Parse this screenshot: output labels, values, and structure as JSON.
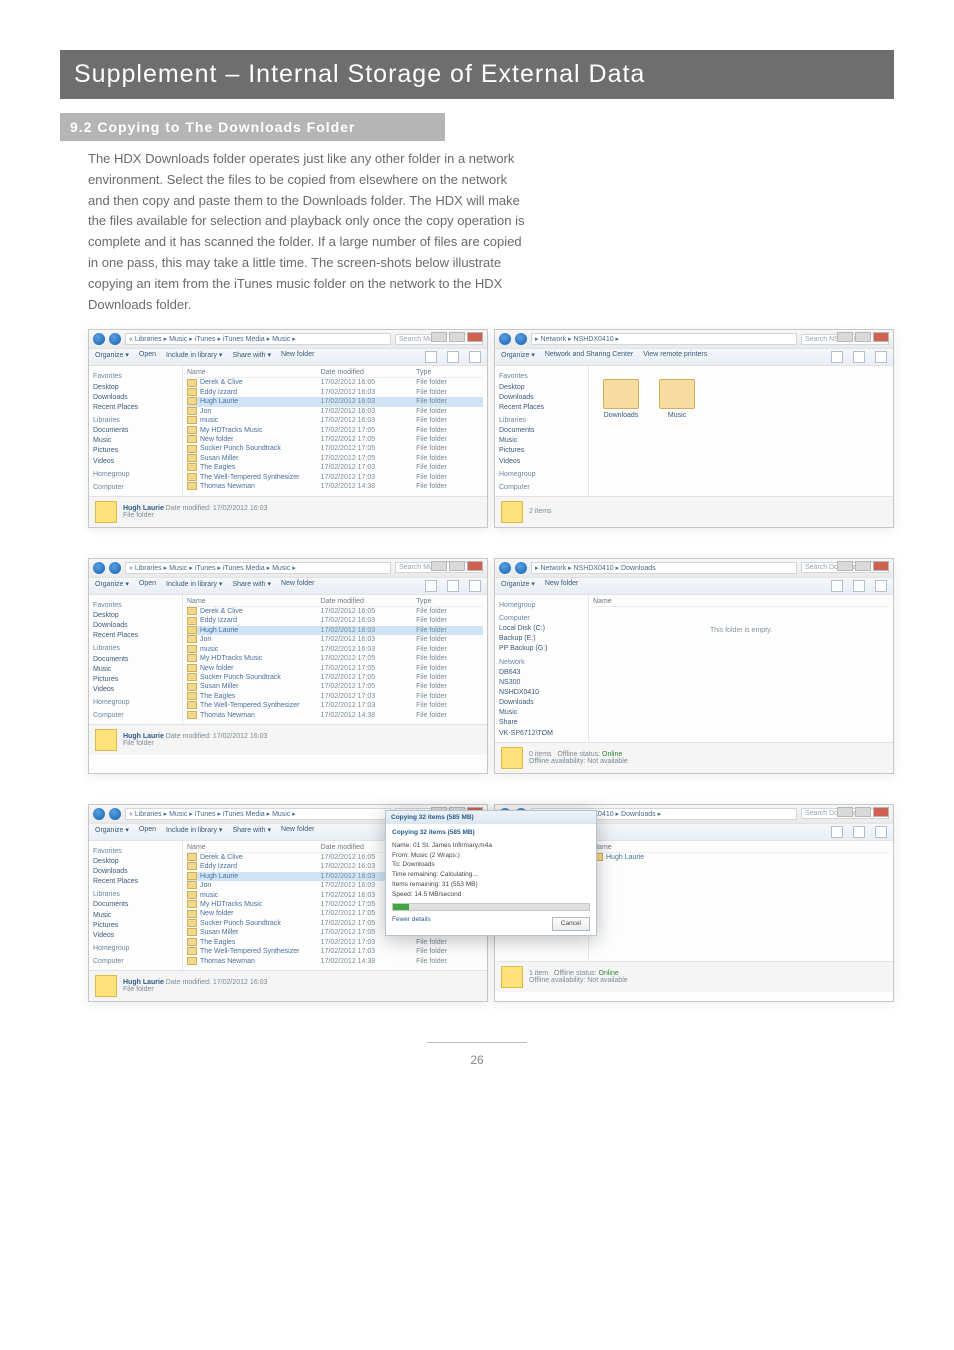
{
  "page": {
    "chapter_title": "Supplement – Internal Storage of External Data",
    "section_title": "9.2 Copying to The Downloads Folder",
    "paragraph": "The HDX Downloads folder operates just like any other folder in a network environment. Select the files to be copied from elsewhere on the network and then copy and paste them to the Downloads folder. The HDX will make the files available for selection and playback only once the copy operation is complete and it has scanned the folder. If a large number of files are copied in one pass, this may take a little time. The screen-shots below illustrate copying an item from the iTunes music folder on the network to the HDX Downloads folder.",
    "page_number": "26"
  },
  "common": {
    "toolbar": {
      "organize": "Organize ▾",
      "open": "Open",
      "include": "Include in library ▾",
      "sharewith": "Share with ▾",
      "newfolder": "New folder",
      "networkcenter": "Network and Sharing Center",
      "viewprinters": "View remote printers"
    },
    "cols": {
      "name": "Name",
      "date": "Date modified",
      "type": "Type"
    },
    "side": {
      "favorites": "Favorites",
      "desktop": "Desktop",
      "downloads": "Downloads",
      "recent": "Recent Places",
      "libraries": "Libraries",
      "documents": "Documents",
      "music": "Music",
      "pictures": "Pictures",
      "videos": "Videos",
      "homegroup": "Homegroup",
      "computer": "Computer",
      "localdisk": "Local Disk (C:)",
      "backup_e": "Backup (E:)",
      "ppbackup": "PP Backup (G:)",
      "network": "Network",
      "db643": "DB643",
      "ns300": "NS300",
      "nshdx": "NSHDX0410",
      "share": "Share",
      "mtp": "VK-SP6712\\TOM"
    },
    "footer": {
      "name": "Hugh Laurie",
      "date_label": "Date modified:",
      "date_val": "17/02/2012 16:03",
      "type": "File folder"
    },
    "items_label": "2 items",
    "offline_status_lbl": "Offline status:",
    "offline_status_val": "Online",
    "offline_avail_lbl": "Offline availability:",
    "offline_avail_val": "Not available",
    "one_item": "1 item"
  },
  "left_common": {
    "path": "« Libraries ▸ Music ▸ iTunes ▸ iTunes Media ▸ Music ▸",
    "search": "Search Music",
    "rows": [
      {
        "n": "Derek & Clive",
        "d": "17/02/2012 16:05",
        "t": "File folder"
      },
      {
        "n": "Eddy Izzard",
        "d": "17/02/2012 16:03",
        "t": "File folder"
      },
      {
        "n": "Hugh Laurie",
        "d": "17/02/2012 16:03",
        "t": "File folder",
        "sel": true
      },
      {
        "n": "Jon",
        "d": "17/02/2012 16:03",
        "t": "File folder"
      },
      {
        "n": "music",
        "d": "17/02/2012 16:03",
        "t": "File folder"
      },
      {
        "n": "My HDTracks Music",
        "d": "17/02/2012 17:05",
        "t": "File folder"
      },
      {
        "n": "New folder",
        "d": "17/02/2012 17:05",
        "t": "File folder"
      },
      {
        "n": "Sucker Punch Soundtrack",
        "d": "17/02/2012 17:05",
        "t": "File folder"
      },
      {
        "n": "Susan Miller",
        "d": "17/02/2012 17:05",
        "t": "File folder"
      },
      {
        "n": "The Eagles",
        "d": "17/02/2012 17:03",
        "t": "File folder"
      },
      {
        "n": "The Well-Tempered Synthesizer",
        "d": "17/02/2012 17:03",
        "t": "File folder"
      },
      {
        "n": "Thomas Newman",
        "d": "17/02/2012 14:38",
        "t": "File folder"
      }
    ]
  },
  "shot1_right": {
    "path": "▸ Network ▸ NSHDX0410 ▸",
    "search": "Search NSHDX0410",
    "thumb1": "Downloads",
    "thumb2": "Music"
  },
  "shot2_right": {
    "path": "▸ Network ▸ NSHDX0410 ▸ Downloads",
    "search": "Search Downloads",
    "empty": "This folder is empty.",
    "footer_items": "0 items"
  },
  "shot3_right": {
    "path": "▸ Network ▸ NSHDX0410 ▸ Downloads ▸",
    "search": "Search Downloads",
    "item_name": "Hugh Laurie"
  },
  "dialog": {
    "title": "Copying 32 items (585 MB)",
    "heading": "Copying 32 items (585 MB)",
    "name_lbl": "Name:",
    "name_val": "01 St. James Infirmary.m4a",
    "from_lbl": "From:",
    "from_val": "Music (2 Wraps:)",
    "to_lbl": "To:",
    "to_val": "Downloads",
    "time_lbl": "Time remaining:",
    "time_val": "Calculating...",
    "items_lbl": "Items remaining:",
    "items_val": "31 (553 MB)",
    "speed_lbl": "Speed:",
    "speed_val": "14.5 MB/second",
    "fewer": "Fewer details",
    "cancel": "Cancel"
  }
}
